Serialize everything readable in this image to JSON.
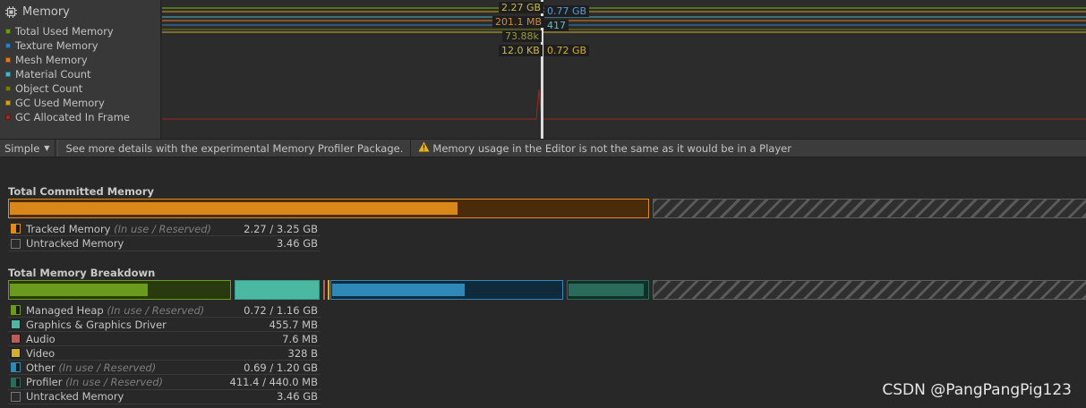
{
  "profiler_module": {
    "title": "Memory",
    "icon": "memory-chip-icon",
    "legend": [
      {
        "label": "Total Used Memory",
        "color": "#6a9a1e"
      },
      {
        "label": "Texture Memory",
        "color": "#2f7fc4"
      },
      {
        "label": "Mesh Memory",
        "color": "#e07b1a"
      },
      {
        "label": "Material Count",
        "color": "#47b6c8"
      },
      {
        "label": "Object Count",
        "color": "#7a7a10"
      },
      {
        "label": "GC Used Memory",
        "color": "#d4a017"
      },
      {
        "label": "GC Allocated In Frame",
        "color": "#9b2a20"
      }
    ]
  },
  "chart_tooltips": {
    "left": [
      "2.27 GB",
      "201.1 MB",
      "73.88k",
      "12.0 KB"
    ],
    "right": [
      "0.77 GB",
      "417",
      "0.72 GB"
    ]
  },
  "toolbar": {
    "mode": "Simple",
    "hint": "See more details with the experimental Memory Profiler Package.",
    "warning": "Memory usage in the Editor is not the same as it would be in a Player"
  },
  "committed": {
    "title": "Total Committed Memory",
    "tracked_fraction_of_total": 0.485,
    "in_use_fraction_of_tracked": 0.7,
    "rows": [
      {
        "label": "Tracked Memory",
        "note": "(In use / Reserved)",
        "value": "2.27 / 3.25 GB",
        "color": "#e08b1c",
        "icon": "tracked-swatch"
      },
      {
        "label": "Untracked Memory",
        "note": "",
        "value": "3.46 GB",
        "color": "#2b2b2b",
        "icon": "untracked-swatch"
      }
    ]
  },
  "breakdown": {
    "title": "Total Memory Breakdown",
    "rows": [
      {
        "label": "Managed Heap",
        "note": "(In use / Reserved)",
        "value": "0.72 / 1.16 GB",
        "color": "#6a9a1e"
      },
      {
        "label": "Graphics & Graphics Driver",
        "note": "",
        "value": "455.7 MB",
        "color": "#4bb8a2"
      },
      {
        "label": "Audio",
        "note": "",
        "value": "7.6 MB",
        "color": "#c05a5a"
      },
      {
        "label": "Video",
        "note": "",
        "value": "328 B",
        "color": "#d4b02a"
      },
      {
        "label": "Other",
        "note": "(In use / Reserved)",
        "value": "0.69 / 1.20 GB",
        "color": "#2f89b8"
      },
      {
        "label": "Profiler",
        "note": "(In use / Reserved)",
        "value": "411.4 / 440.0 MB",
        "color": "#2a6b5b"
      },
      {
        "label": "Untracked Memory",
        "note": "",
        "value": "3.46 GB",
        "color": "#2b2b2b"
      }
    ]
  },
  "watermark": "CSDN @PangPangPig123"
}
